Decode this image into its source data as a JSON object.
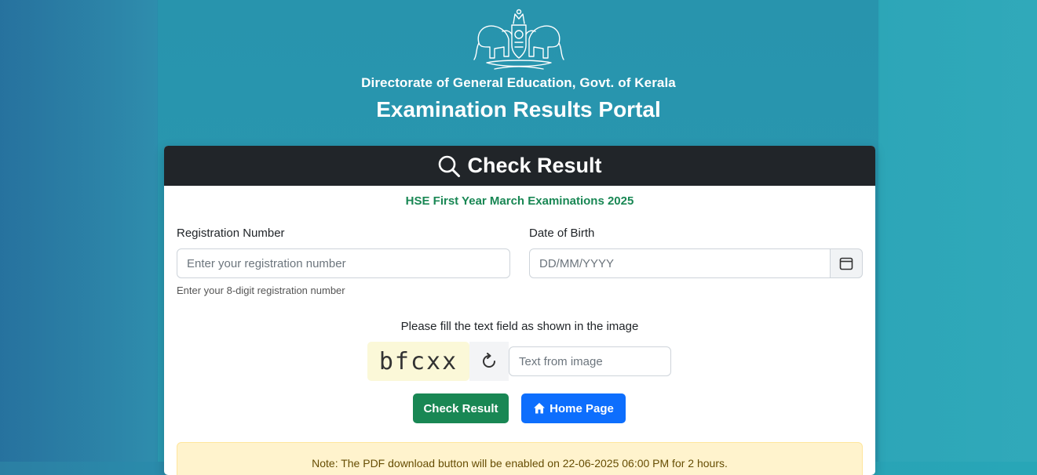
{
  "header": {
    "department": "Directorate of General Education, Govt. of Kerala",
    "portal_title": "Examination Results Portal",
    "emblem_icon": "kerala-emblem-icon"
  },
  "card": {
    "title": "Check Result",
    "exam_name": "HSE First Year March Examinations 2025"
  },
  "form": {
    "registration": {
      "label": "Registration Number",
      "placeholder": "Enter your registration number",
      "help": "Enter your 8-digit registration number"
    },
    "dob": {
      "label": "Date of Birth",
      "placeholder": "DD/MM/YYYY"
    },
    "captcha": {
      "instruction": "Please fill the text field as shown in the image",
      "image_text": "bfcxx",
      "placeholder": "Text from image"
    }
  },
  "buttons": {
    "check_result": "Check Result",
    "home_page": "Home Page"
  },
  "alert": {
    "text": "Note: The PDF download button will be enabled on 22-06-2025 06:00 PM for 2 hours."
  },
  "colors": {
    "primary_blue": "#0d6efd",
    "success_green": "#198754",
    "dark_header": "#212529",
    "alert_bg": "#fff3cd"
  }
}
